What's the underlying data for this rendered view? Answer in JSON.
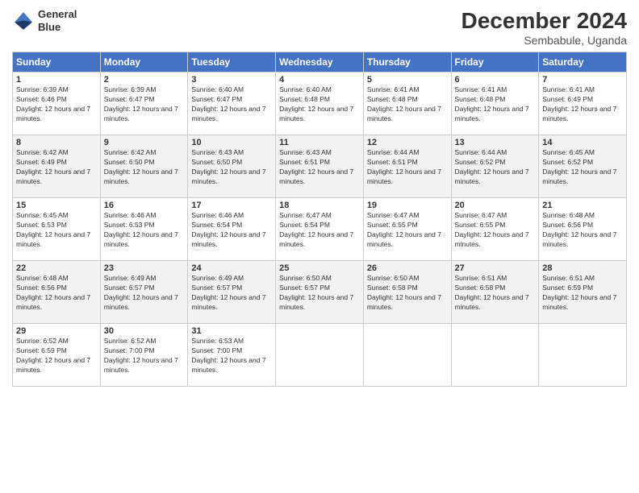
{
  "logo": {
    "line1": "General",
    "line2": "Blue"
  },
  "title": "December 2024",
  "subtitle": "Sembabule, Uganda",
  "header": {
    "days": [
      "Sunday",
      "Monday",
      "Tuesday",
      "Wednesday",
      "Thursday",
      "Friday",
      "Saturday"
    ]
  },
  "weeks": [
    [
      {
        "day": "1",
        "sunrise": "6:39 AM",
        "sunset": "6:46 PM",
        "daylight": "12 hours and 7 minutes."
      },
      {
        "day": "2",
        "sunrise": "6:39 AM",
        "sunset": "6:47 PM",
        "daylight": "12 hours and 7 minutes."
      },
      {
        "day": "3",
        "sunrise": "6:40 AM",
        "sunset": "6:47 PM",
        "daylight": "12 hours and 7 minutes."
      },
      {
        "day": "4",
        "sunrise": "6:40 AM",
        "sunset": "6:48 PM",
        "daylight": "12 hours and 7 minutes."
      },
      {
        "day": "5",
        "sunrise": "6:41 AM",
        "sunset": "6:48 PM",
        "daylight": "12 hours and 7 minutes."
      },
      {
        "day": "6",
        "sunrise": "6:41 AM",
        "sunset": "6:48 PM",
        "daylight": "12 hours and 7 minutes."
      },
      {
        "day": "7",
        "sunrise": "6:41 AM",
        "sunset": "6:49 PM",
        "daylight": "12 hours and 7 minutes."
      }
    ],
    [
      {
        "day": "8",
        "sunrise": "6:42 AM",
        "sunset": "6:49 PM",
        "daylight": "12 hours and 7 minutes."
      },
      {
        "day": "9",
        "sunrise": "6:42 AM",
        "sunset": "6:50 PM",
        "daylight": "12 hours and 7 minutes."
      },
      {
        "day": "10",
        "sunrise": "6:43 AM",
        "sunset": "6:50 PM",
        "daylight": "12 hours and 7 minutes."
      },
      {
        "day": "11",
        "sunrise": "6:43 AM",
        "sunset": "6:51 PM",
        "daylight": "12 hours and 7 minutes."
      },
      {
        "day": "12",
        "sunrise": "6:44 AM",
        "sunset": "6:51 PM",
        "daylight": "12 hours and 7 minutes."
      },
      {
        "day": "13",
        "sunrise": "6:44 AM",
        "sunset": "6:52 PM",
        "daylight": "12 hours and 7 minutes."
      },
      {
        "day": "14",
        "sunrise": "6:45 AM",
        "sunset": "6:52 PM",
        "daylight": "12 hours and 7 minutes."
      }
    ],
    [
      {
        "day": "15",
        "sunrise": "6:45 AM",
        "sunset": "6:53 PM",
        "daylight": "12 hours and 7 minutes."
      },
      {
        "day": "16",
        "sunrise": "6:46 AM",
        "sunset": "6:53 PM",
        "daylight": "12 hours and 7 minutes."
      },
      {
        "day": "17",
        "sunrise": "6:46 AM",
        "sunset": "6:54 PM",
        "daylight": "12 hours and 7 minutes."
      },
      {
        "day": "18",
        "sunrise": "6:47 AM",
        "sunset": "6:54 PM",
        "daylight": "12 hours and 7 minutes."
      },
      {
        "day": "19",
        "sunrise": "6:47 AM",
        "sunset": "6:55 PM",
        "daylight": "12 hours and 7 minutes."
      },
      {
        "day": "20",
        "sunrise": "6:47 AM",
        "sunset": "6:55 PM",
        "daylight": "12 hours and 7 minutes."
      },
      {
        "day": "21",
        "sunrise": "6:48 AM",
        "sunset": "6:56 PM",
        "daylight": "12 hours and 7 minutes."
      }
    ],
    [
      {
        "day": "22",
        "sunrise": "6:48 AM",
        "sunset": "6:56 PM",
        "daylight": "12 hours and 7 minutes."
      },
      {
        "day": "23",
        "sunrise": "6:49 AM",
        "sunset": "6:57 PM",
        "daylight": "12 hours and 7 minutes."
      },
      {
        "day": "24",
        "sunrise": "6:49 AM",
        "sunset": "6:57 PM",
        "daylight": "12 hours and 7 minutes."
      },
      {
        "day": "25",
        "sunrise": "6:50 AM",
        "sunset": "6:57 PM",
        "daylight": "12 hours and 7 minutes."
      },
      {
        "day": "26",
        "sunrise": "6:50 AM",
        "sunset": "6:58 PM",
        "daylight": "12 hours and 7 minutes."
      },
      {
        "day": "27",
        "sunrise": "6:51 AM",
        "sunset": "6:58 PM",
        "daylight": "12 hours and 7 minutes."
      },
      {
        "day": "28",
        "sunrise": "6:51 AM",
        "sunset": "6:59 PM",
        "daylight": "12 hours and 7 minutes."
      }
    ],
    [
      {
        "day": "29",
        "sunrise": "6:52 AM",
        "sunset": "6:59 PM",
        "daylight": "12 hours and 7 minutes."
      },
      {
        "day": "30",
        "sunrise": "6:52 AM",
        "sunset": "7:00 PM",
        "daylight": "12 hours and 7 minutes."
      },
      {
        "day": "31",
        "sunrise": "6:53 AM",
        "sunset": "7:00 PM",
        "daylight": "12 hours and 7 minutes."
      },
      null,
      null,
      null,
      null
    ]
  ]
}
